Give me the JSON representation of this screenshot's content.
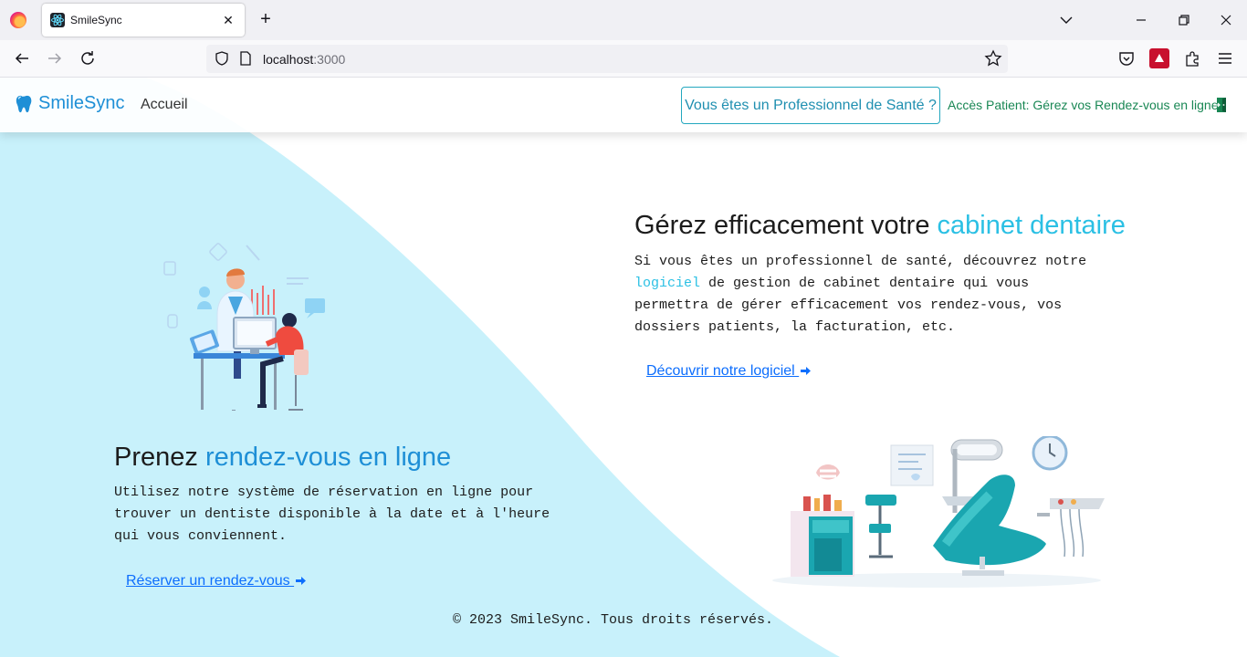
{
  "browser": {
    "tab_title": "SmileSync",
    "url_host": "localhost",
    "url_port": ":3000"
  },
  "nav": {
    "brand": "SmileSync",
    "home": "Accueil",
    "pro_button": "Vous êtes un Professionnel de Santé ?",
    "patient_link": "Accès Patient: Gérez vos Rendez-vous en ligne"
  },
  "pro_section": {
    "title_plain": "Gérez efficacement votre ",
    "title_accent": "cabinet dentaire",
    "text_1": "Si vous êtes un professionnel de santé, découvrez notre",
    "text_2_accent": "logiciel",
    "text_2_rest": " de gestion de cabinet dentaire qui vous",
    "text_3": "permettra de gérer efficacement vos rendez-vous, vos",
    "text_4": "dossiers patients, la facturation, etc.",
    "cta": "Découvrir notre logiciel "
  },
  "patient_section": {
    "title_plain": "Prenez ",
    "title_accent": "rendez-vous en ligne",
    "text_1": "Utilisez notre système de réservation en ligne pour",
    "text_2": "trouver un dentiste disponible à la date et à l'heure",
    "text_3": "qui vous conviennent.",
    "cta": "Réserver un rendez-vous "
  },
  "footer": "© 2023 SmileSync. Tous droits réservés.",
  "colors": {
    "accent_cyan": "#2bc0e4",
    "accent_blue": "#1e8fd6",
    "wave_bg": "#c8f1fb",
    "link_blue": "#0d6efd",
    "patient_green": "#198754"
  }
}
